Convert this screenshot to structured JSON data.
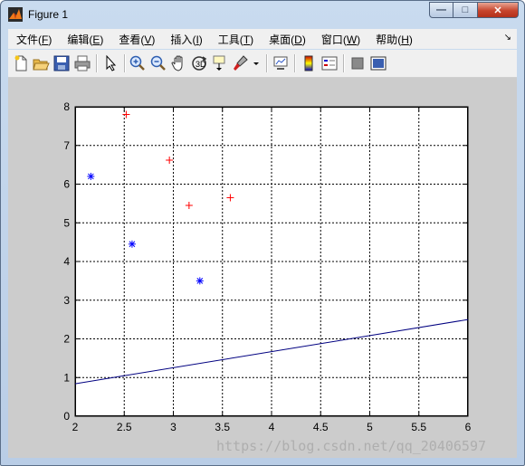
{
  "window": {
    "title": "Figure 1"
  },
  "controls": {
    "minimize": "—",
    "maximize": "□",
    "close": "✕"
  },
  "menu": [
    {
      "label": "文件",
      "key": "F"
    },
    {
      "label": "编辑",
      "key": "E"
    },
    {
      "label": "查看",
      "key": "V"
    },
    {
      "label": "插入",
      "key": "I"
    },
    {
      "label": "工具",
      "key": "T"
    },
    {
      "label": "桌面",
      "key": "D"
    },
    {
      "label": "窗口",
      "key": "W"
    },
    {
      "label": "帮助",
      "key": "H"
    }
  ],
  "menu_dock": "↘",
  "toolbar": [
    "new-figure-icon",
    "open-file-icon",
    "save-icon",
    "print-icon",
    "pointer-icon",
    "zoom-in-icon",
    "zoom-out-icon",
    "pan-hand-icon",
    "rotate-3d-icon",
    "data-cursor-icon",
    "brush-icon",
    "brush-dropdown-icon",
    "link-plot-icon",
    "colorbar-icon",
    "legend-icon",
    "hide-plot-tools-icon",
    "show-plot-tools-icon"
  ],
  "colors": {
    "red_series": "#ff0000",
    "blue_series": "#0000ff",
    "line": "#000080",
    "figure_bg": "#cccccc"
  },
  "chart_data": {
    "type": "scatter",
    "xlim": [
      2,
      6
    ],
    "ylim": [
      0,
      8
    ],
    "xticks": [
      2,
      2.5,
      3,
      3.5,
      4,
      4.5,
      5,
      5.5,
      6
    ],
    "yticks": [
      0,
      1,
      2,
      3,
      4,
      5,
      6,
      7,
      8
    ],
    "grid": true,
    "grid_style": "dotted",
    "series": [
      {
        "marker": "+",
        "color": "#ff0000",
        "points": [
          [
            2.52,
            7.8
          ],
          [
            2.96,
            6.62
          ],
          [
            3.16,
            5.45
          ],
          [
            3.58,
            5.65
          ]
        ]
      },
      {
        "marker": "*",
        "color": "#0000ff",
        "points": [
          [
            2.16,
            6.2
          ],
          [
            2.58,
            4.45
          ],
          [
            3.27,
            3.5
          ]
        ]
      }
    ],
    "lines": [
      {
        "color": "#000080",
        "points": [
          [
            2.0,
            0.84
          ],
          [
            6.0,
            2.5
          ]
        ]
      }
    ]
  },
  "watermark": "https://blog.csdn.net/qq_20406597"
}
